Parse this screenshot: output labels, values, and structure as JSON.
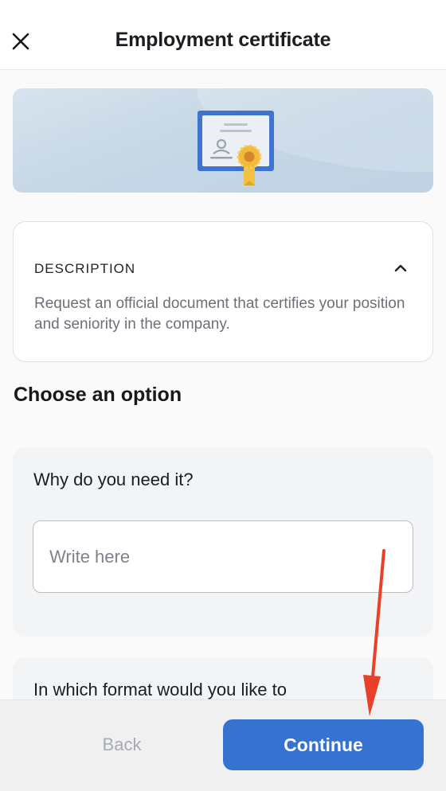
{
  "header": {
    "title": "Employment certificate",
    "close_icon": "close-icon"
  },
  "hero": {
    "illustration": "certificate-icon"
  },
  "description": {
    "label": "DESCRIPTION",
    "text": "Request an official document that certifies your position and seniority in the company.",
    "toggle_icon": "chevron-up-icon",
    "expanded": true
  },
  "options": {
    "title": "Choose an option",
    "question_1": {
      "label": "Why do you need it?",
      "placeholder": "Write here",
      "value": ""
    },
    "question_2": {
      "label": "In which format would you like to"
    }
  },
  "footer": {
    "back_label": "Back",
    "continue_label": "Continue"
  },
  "colors": {
    "primary": "#3673d1",
    "annotation_arrow": "#e8402a",
    "hero_bg": "#c6d7e6"
  }
}
